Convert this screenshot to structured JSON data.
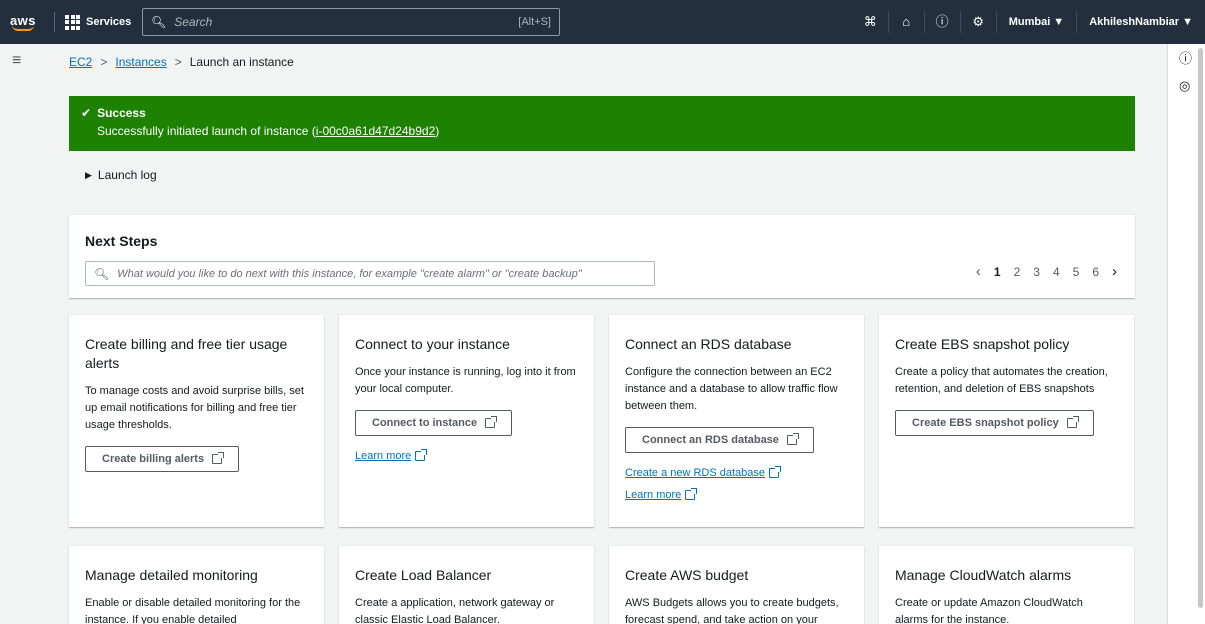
{
  "topnav": {
    "logo": "aws",
    "services_label": "Services",
    "search_placeholder": "Search",
    "search_shortcut": "[Alt+S]",
    "region": "Mumbai ▼",
    "user": "AkhileshNambiar ▼"
  },
  "breadcrumb": {
    "ec2": "EC2",
    "instances": "Instances",
    "current": "Launch an instance",
    "separator": ">"
  },
  "banner": {
    "title": "Success",
    "message": "Successfully initiated launch of instance (",
    "instance_id": "i-00c0a61d47d24b9d2",
    "message_end": ")",
    "color": "#1d8102"
  },
  "launch_log": "Launch log",
  "next_steps": {
    "title": "Next Steps",
    "search_placeholder": "What would you like to do next with this instance, for example \"create alarm\" or \"create backup\"",
    "pages": [
      "1",
      "2",
      "3",
      "4",
      "5",
      "6"
    ],
    "current_page": "1"
  },
  "cards": [
    {
      "title": "Create billing and free tier usage alerts",
      "description": "To manage costs and avoid surprise bills, set up email notifications for billing and free tier usage thresholds.",
      "button": "Create billing alerts"
    },
    {
      "title": "Connect to your instance",
      "description": "Once your instance is running, log into it from your local computer.",
      "button": "Connect to instance",
      "link1": "Learn more"
    },
    {
      "title": "Connect an RDS database",
      "description": "Configure the connection between an EC2 instance and a database to allow traffic flow between them.",
      "button": "Connect an RDS database",
      "link1": "Create a new RDS database",
      "link2": "Learn more"
    },
    {
      "title": "Create EBS snapshot policy",
      "description": "Create a policy that automates the creation, retention, and deletion of EBS snapshots",
      "button": "Create EBS snapshot policy"
    },
    {
      "title": "Manage detailed monitoring",
      "description": "Enable or disable detailed monitoring for the instance. If you enable detailed"
    },
    {
      "title": "Create Load Balancer",
      "description": "Create a application, network gateway or classic Elastic Load Balancer."
    },
    {
      "title": "Create AWS budget",
      "description": "AWS Budgets allows you to create budgets, forecast spend, and take action on your"
    },
    {
      "title": "Manage CloudWatch alarms",
      "description": "Create or update Amazon CloudWatch alarms for the instance."
    }
  ],
  "icons": {
    "nav": [
      "cloudshell-icon",
      "notifications-icon",
      "help-icon",
      "settings-icon"
    ],
    "right_panel": [
      "info-icon",
      "feedback-icon"
    ]
  },
  "colors": {
    "nav_bg": "#232f3e",
    "link": "#0073bb",
    "brand_accent": "#ff9900"
  }
}
